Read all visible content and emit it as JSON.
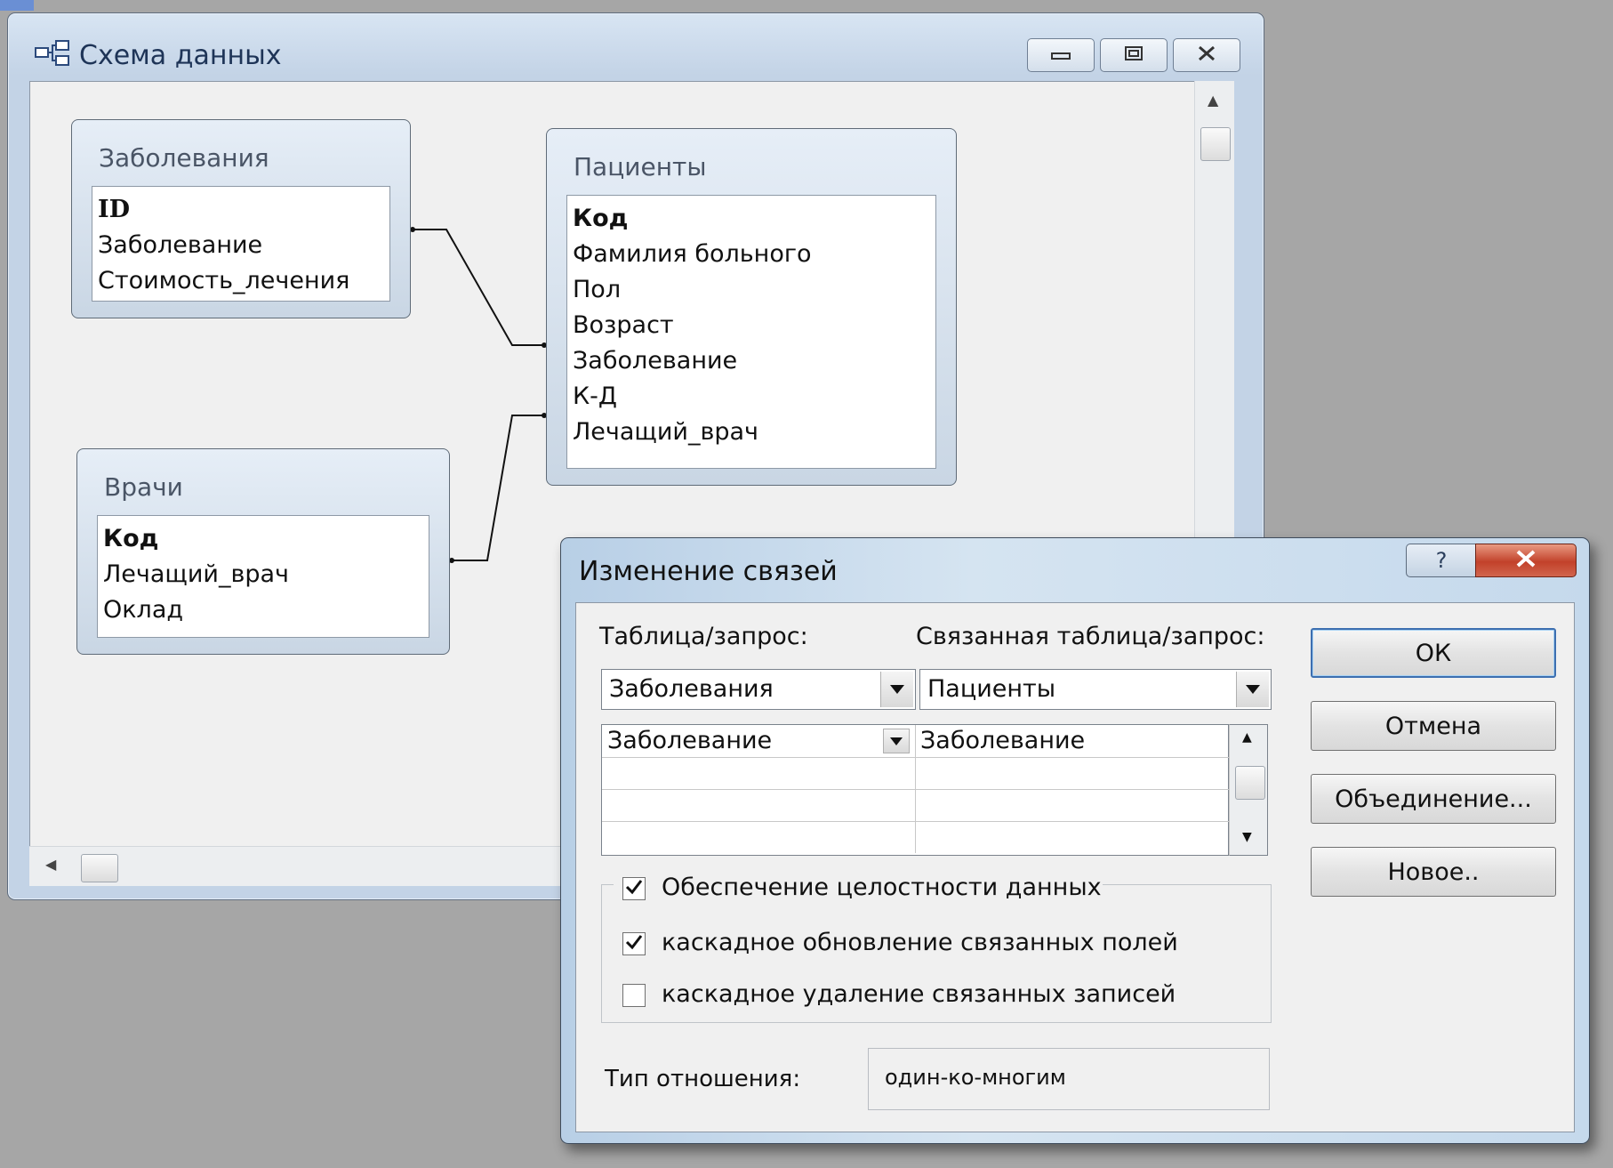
{
  "main_window": {
    "title": "Схема данных",
    "title_icon": "relationships-icon",
    "caption_buttons": [
      "minimize-icon",
      "maximize-icon",
      "close-icon"
    ]
  },
  "tables": {
    "diseases": {
      "title": "Заболевания",
      "fields": [
        "ID",
        "Заболевание",
        "Стоимость_лечения"
      ]
    },
    "patients": {
      "title": "Пациенты",
      "fields": [
        "Код",
        "Фамилия больного",
        "Пол",
        "Возраст",
        "Заболевание",
        "К-Д",
        "Лечащий_врач"
      ]
    },
    "doctors": {
      "title": "Врачи",
      "fields": [
        "Код",
        "Лечащий_врач",
        "Оклад"
      ]
    }
  },
  "dialog": {
    "title": "Изменение связей",
    "help_glyph": "?",
    "table_label": "Таблица/запрос:",
    "related_table_label": "Связанная таблица/запрос:",
    "table_value": "Заболевания",
    "related_table_value": "Пациенты",
    "field_pairs": [
      {
        "left": "Заболевание",
        "right": "Заболевание"
      },
      {
        "left": "",
        "right": ""
      },
      {
        "left": "",
        "right": ""
      },
      {
        "left": "",
        "right": ""
      }
    ],
    "enforce_integrity": {
      "label": "Обеспечение целостности данных",
      "checked": true
    },
    "cascade_update": {
      "label": "каскадное обновление связанных полей",
      "checked": true
    },
    "cascade_delete": {
      "label": "каскадное удаление связанных записей",
      "checked": false
    },
    "relationship_type_label": "Тип отношения:",
    "relationship_type_value": "один-ко-многим",
    "buttons": {
      "ok": "ОК",
      "cancel": "Отмена",
      "join": "Объединение...",
      "new": "Новое.."
    }
  },
  "colors": {
    "dialog_close": "#c2412a",
    "default_button_border": "#3d6fb0"
  }
}
